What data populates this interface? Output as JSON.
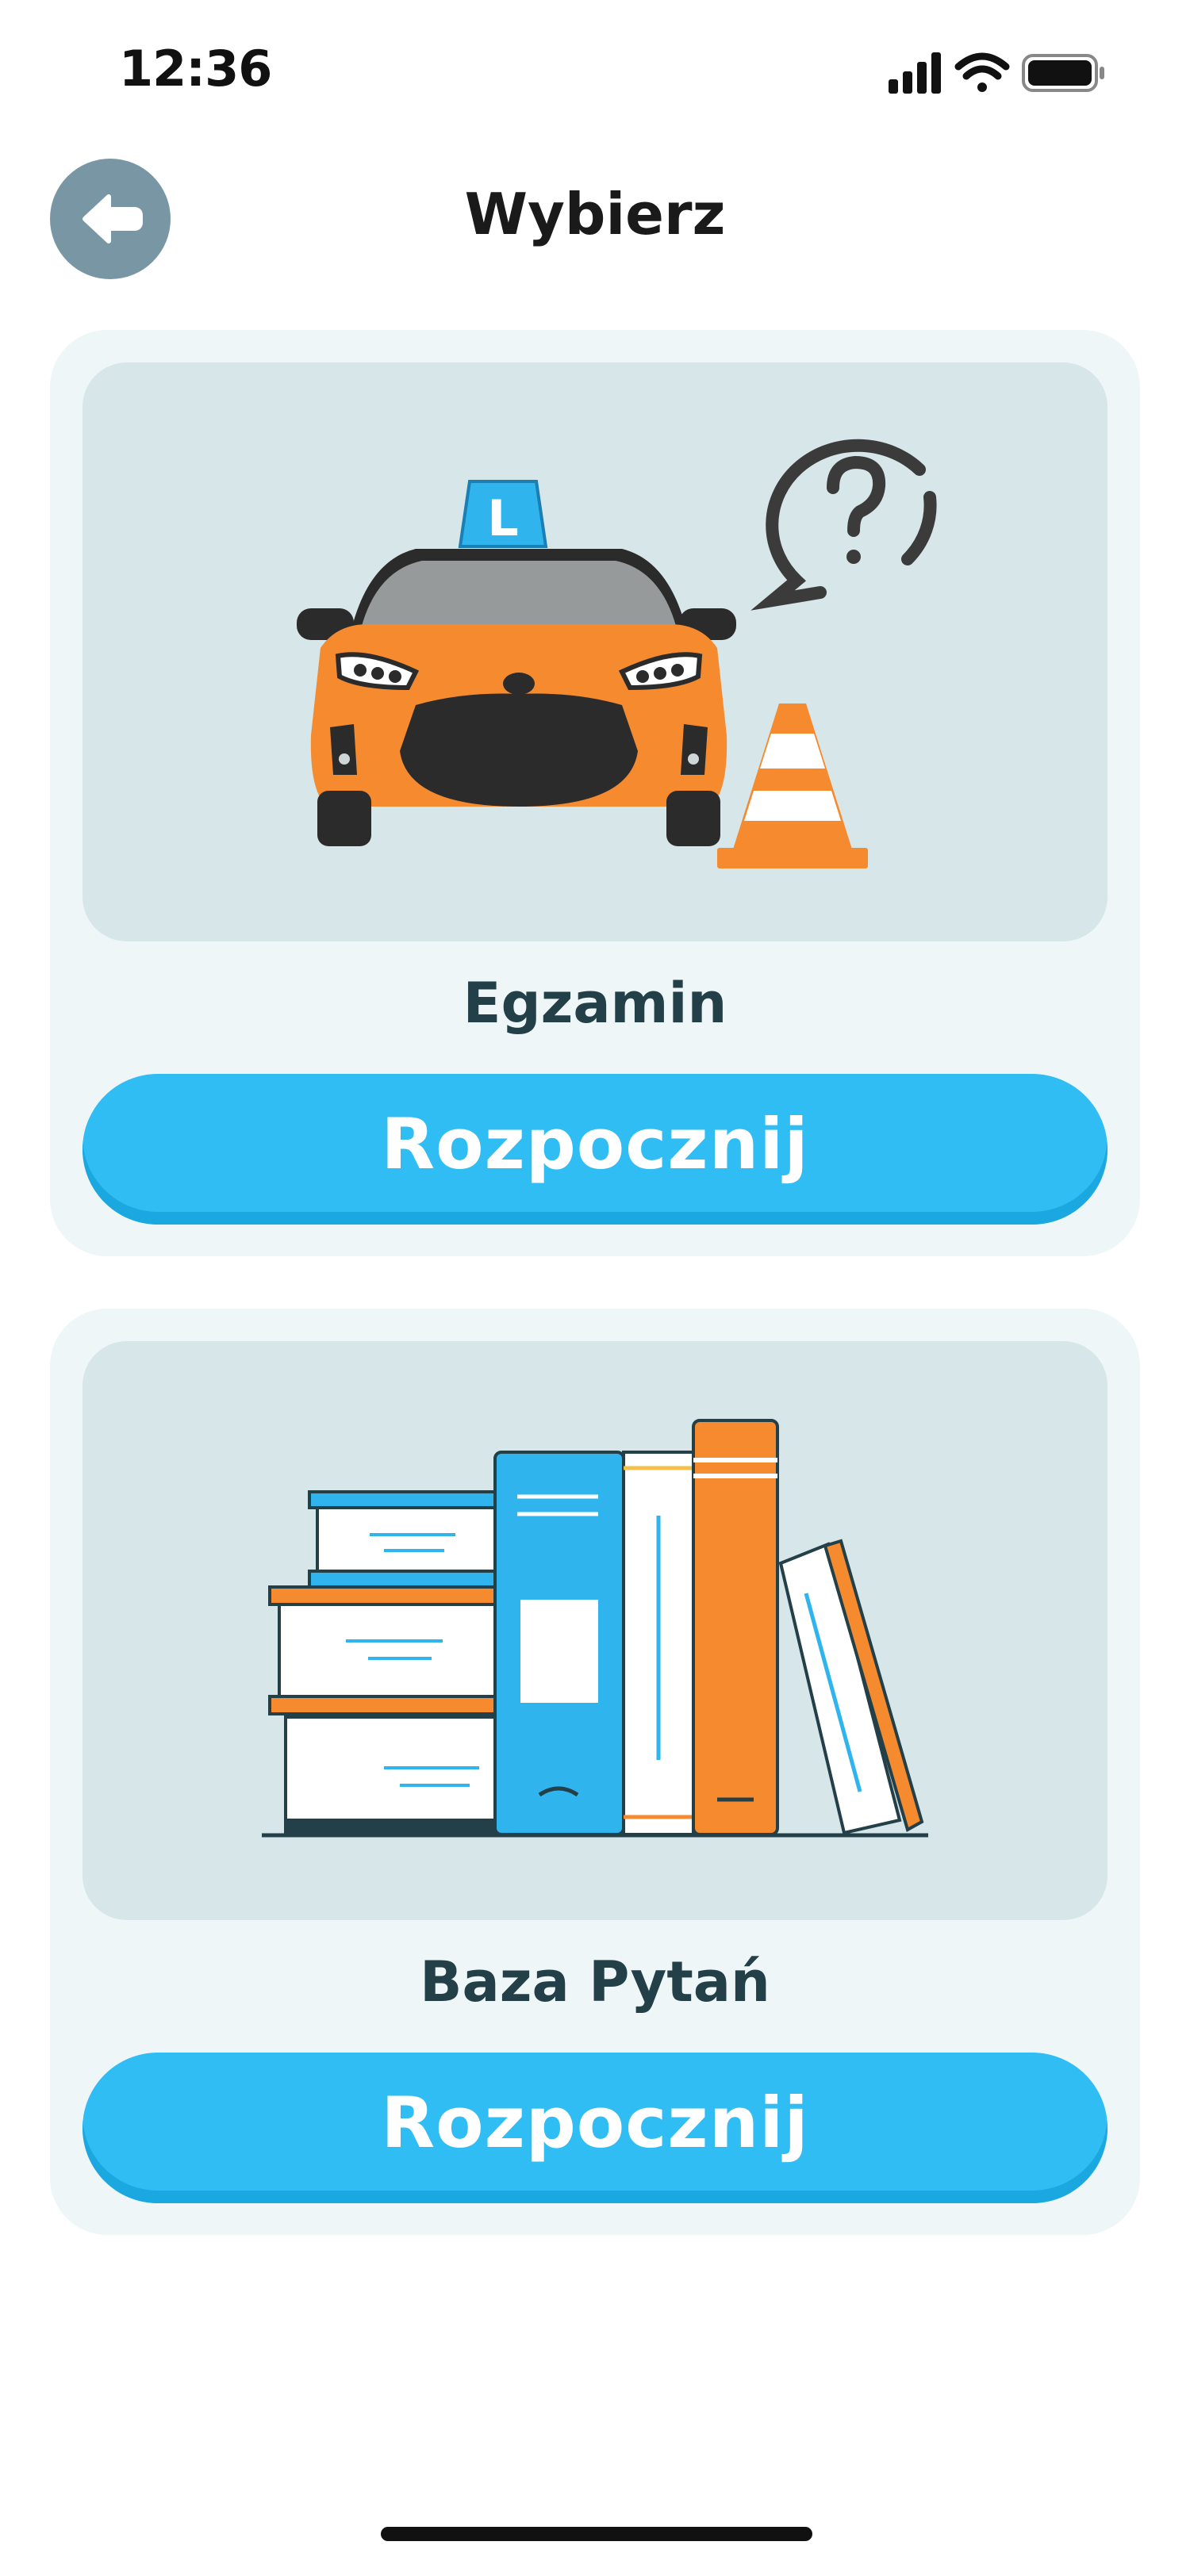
{
  "status_bar": {
    "time": "12:36"
  },
  "header": {
    "title": "Wybierz"
  },
  "cards": [
    {
      "title": "Egzamin",
      "button_label": "Rozpocznij",
      "illustration": "learner-car-with-cone-and-question"
    },
    {
      "title": "Baza Pytań",
      "button_label": "Rozpocznij",
      "illustration": "stack-of-books"
    }
  ],
  "colors": {
    "accent": "#2fbdf4",
    "back_button": "#7896a3",
    "card_bg": "#eef6f8",
    "image_bg": "#d6e6e9",
    "title_text": "#233f48"
  }
}
